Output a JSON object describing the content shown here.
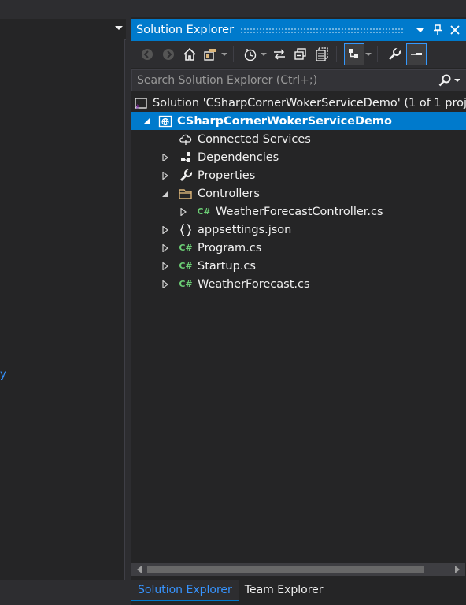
{
  "left_pane": {
    "link_text": "y"
  },
  "solution_explorer": {
    "title": "Solution Explorer",
    "search_placeholder": "Search Solution Explorer (Ctrl+;)",
    "tree": [
      {
        "label": "Solution 'CSharpCornerWokerServiceDemo' (1 of 1 proj",
        "icon": "solution-icon",
        "expander": "none"
      },
      {
        "label": "CSharpCornerWokerServiceDemo",
        "icon": "web-project-icon",
        "expander": "expanded",
        "selected": true
      },
      {
        "label": "Connected Services",
        "icon": "connected-services-icon",
        "expander": "none"
      },
      {
        "label": "Dependencies",
        "icon": "dependencies-icon",
        "expander": "collapsed"
      },
      {
        "label": "Properties",
        "icon": "wrench-icon",
        "expander": "collapsed"
      },
      {
        "label": "Controllers",
        "icon": "folder-icon",
        "expander": "expanded"
      },
      {
        "label": "WeatherForecastController.cs",
        "icon": "csharp-file-icon",
        "expander": "collapsed"
      },
      {
        "label": "appsettings.json",
        "icon": "json-file-icon",
        "expander": "collapsed"
      },
      {
        "label": "Program.cs",
        "icon": "csharp-file-icon",
        "expander": "collapsed"
      },
      {
        "label": "Startup.cs",
        "icon": "csharp-file-icon",
        "expander": "collapsed"
      },
      {
        "label": "WeatherForecast.cs",
        "icon": "csharp-file-icon",
        "expander": "collapsed"
      }
    ],
    "csharp_badge": "C#",
    "tabs": [
      "Solution Explorer",
      "Team Explorer"
    ],
    "active_tab": "Solution Explorer"
  },
  "colors": {
    "accent": "#007acc",
    "background": "#252526",
    "csharp_green": "#6bcc74"
  }
}
